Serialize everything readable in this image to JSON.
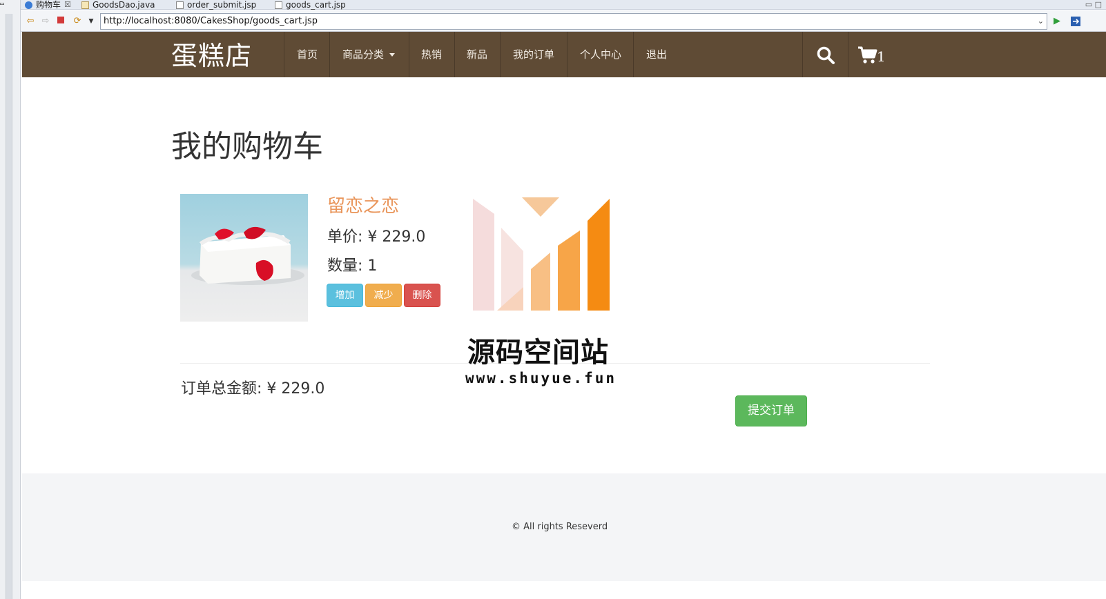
{
  "ide": {
    "tabs": [
      {
        "label": "购物车",
        "icon": "globe-icon",
        "close": "☒"
      },
      {
        "label": "GoodsDao.java",
        "icon": "java-file-icon"
      },
      {
        "label": "order_submit.jsp",
        "icon": "jsp-file-icon"
      },
      {
        "label": "goods_cart.jsp",
        "icon": "jsp-file-icon"
      }
    ],
    "url": "http://localhost:8080/CakesShop/goods_cart.jsp"
  },
  "nav": {
    "brand": "蛋糕店",
    "items": [
      "首页",
      "商品分类",
      "热销",
      "新品",
      "我的订单",
      "个人中心",
      "退出"
    ],
    "cart_count": "1"
  },
  "cart": {
    "title": "我的购物车",
    "item": {
      "name": "留恋之恋",
      "price": "单价: ¥ 229.0",
      "quantity": "数量: 1"
    },
    "buttons": {
      "add": "增加",
      "minus": "减少",
      "delete": "删除"
    },
    "total": "订单总金额: ¥ 229.0",
    "submit": "提交订单"
  },
  "footer": {
    "copyright": "© All rights Reseverd"
  },
  "watermark": {
    "name": "源码空间站",
    "url": "www.shuyue.fun"
  },
  "colors": {
    "navbar": "#5f4b35",
    "product_name": "#e9955a",
    "info": "#5bc0de",
    "warning": "#f0ad4e",
    "danger": "#d9534f",
    "success": "#5cb85c"
  }
}
